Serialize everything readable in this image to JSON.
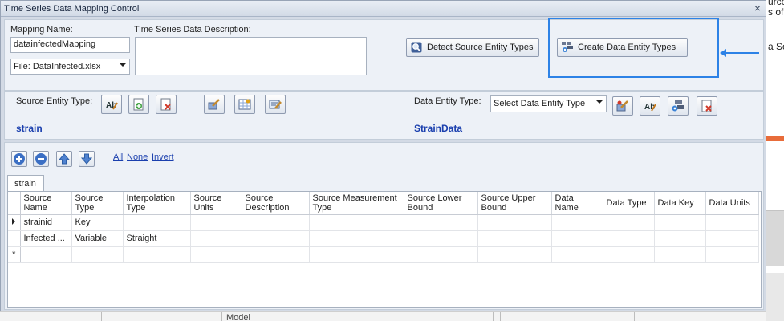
{
  "window": {
    "title": "Time Series Data Mapping Control",
    "close_glyph": "×"
  },
  "mapping": {
    "name_label": "Mapping Name:",
    "name_value": "datainfectedMapping",
    "file_value": "File: DataInfected.xlsx",
    "description_label": "Time Series Data Description:",
    "description_value": ""
  },
  "actions": {
    "detect_label": "Detect Source Entity Types",
    "create_label": "Create Data Entity Types"
  },
  "source_entity": {
    "label": "Source Entity Type:",
    "name": "strain"
  },
  "data_entity": {
    "label": "Data Entity Type:",
    "select_value": "Select Data Entity Type",
    "name": "StrainData"
  },
  "grid_toolbar": {
    "all": "All",
    "none": "None",
    "invert": "Invert"
  },
  "tab": {
    "label": "strain"
  },
  "columns": [
    "Source Name",
    "Source Type",
    "Interpolation Type",
    "Source Units",
    "Source Description",
    "Source Measurement Type",
    "Source Lower Bound",
    "Source Upper Bound",
    "Data Name",
    "Data Type",
    "Data Key",
    "Data Units"
  ],
  "rows": [
    [
      "strainid",
      "Key",
      "",
      "",
      "",
      "",
      "",
      "",
      "",
      "",
      "",
      ""
    ],
    [
      "Infected ...",
      "Variable",
      "Straight",
      "",
      "",
      "",
      "",
      "",
      "",
      "",
      "",
      ""
    ]
  ],
  "new_row_marker": "*",
  "background": {
    "right_fragments": [
      "urce",
      "s of",
      "a So"
    ],
    "bottom_label": "Model"
  },
  "colors": {
    "accent_highlight": "#2d82e6",
    "entity_name": "#1a3fae",
    "link": "#1a3fae"
  }
}
